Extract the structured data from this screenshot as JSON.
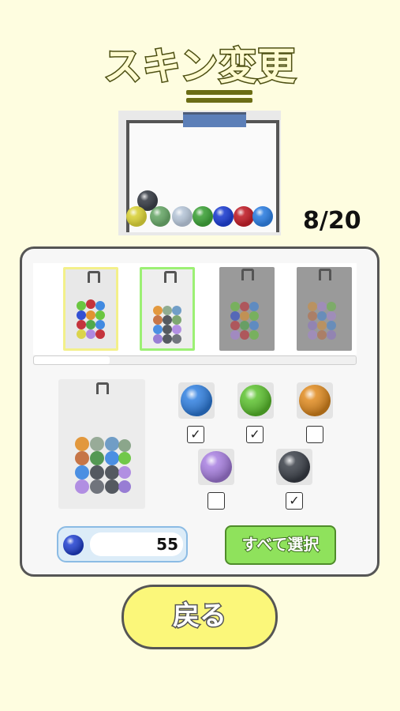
{
  "header": {
    "title": "スキン変更"
  },
  "machine": {
    "progress_text": "8/20"
  },
  "skins": [
    {
      "state": "selected-yellow"
    },
    {
      "state": "selected-green"
    },
    {
      "state": "locked"
    },
    {
      "state": "locked"
    }
  ],
  "colors": [
    {
      "name": "blue",
      "hex": "#2f7fe0",
      "checked": true,
      "mark": "✓"
    },
    {
      "name": "green",
      "hex": "#5cc22e",
      "checked": true,
      "mark": "✓"
    },
    {
      "name": "orange",
      "hex": "#e08a1e",
      "checked": false,
      "mark": ""
    },
    {
      "name": "purple",
      "hex": "#a77ee0",
      "checked": false,
      "mark": ""
    },
    {
      "name": "dark-gray",
      "hex": "#3a3f48",
      "checked": true,
      "mark": "✓"
    }
  ],
  "coins": {
    "value": "55",
    "icon": "blue-marble-icon"
  },
  "buttons": {
    "select_all": "すべて選択",
    "back": "戻る"
  }
}
